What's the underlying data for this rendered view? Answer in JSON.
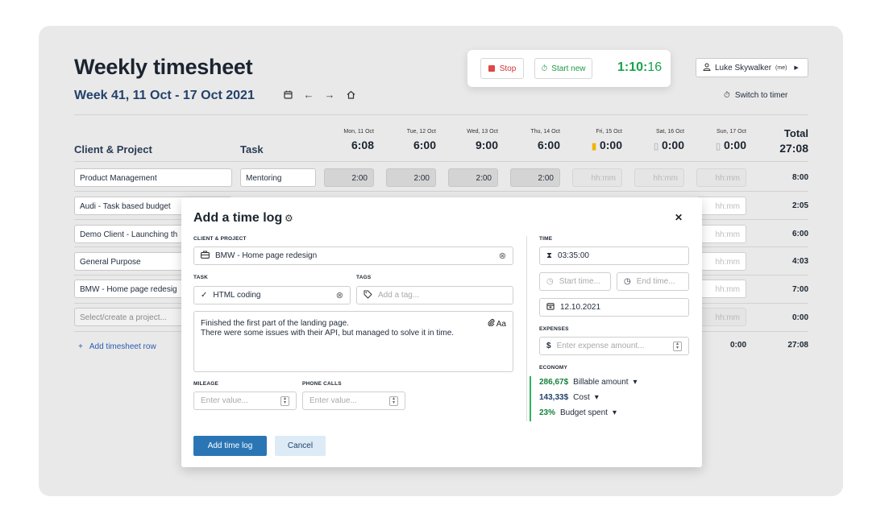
{
  "header": {
    "title": "Weekly timesheet",
    "week_label": "Week 41, 11 Oct - 17 Oct 2021",
    "switch_timer": "Switch to timer"
  },
  "timer": {
    "stop_label": "Stop",
    "start_label": "Start new",
    "clock_main": "1:10:",
    "clock_sec": "16"
  },
  "user": {
    "name": "Luke Skywalker",
    "me": "(me)"
  },
  "table": {
    "col_project": "Client & Project",
    "col_task": "Task",
    "col_total": "Total",
    "days": [
      {
        "name": "Mon, 11 Oct",
        "total": "6:08",
        "indicator": ""
      },
      {
        "name": "Tue, 12 Oct",
        "total": "6:00",
        "indicator": ""
      },
      {
        "name": "Wed, 13 Oct",
        "total": "9:00",
        "indicator": ""
      },
      {
        "name": "Thu, 14 Oct",
        "total": "6:00",
        "indicator": ""
      },
      {
        "name": "Fri, 15 Oct",
        "total": "0:00",
        "indicator": "yellow"
      },
      {
        "name": "Sat, 16 Oct",
        "total": "0:00",
        "indicator": "grey"
      },
      {
        "name": "Sun, 17 Oct",
        "total": "0:00",
        "indicator": "grey"
      }
    ],
    "grand_total": "27:08",
    "rows": [
      {
        "project": "Product Management",
        "task": "Mentoring",
        "cells": [
          "2:00",
          "2:00",
          "2:00",
          "2:00",
          "hh:mm",
          "hh:mm",
          "hh:mm"
        ],
        "total": "8:00"
      },
      {
        "project": "Audi - Task based budget",
        "total": "2:05",
        "sun": "hh:mm"
      },
      {
        "project": "Demo Client - Launching th",
        "total": "6:00",
        "sun": "hh:mm"
      },
      {
        "project": "General Purpose",
        "total": "4:03",
        "sun": "hh:mm"
      },
      {
        "project": "BMW - Home page redesig",
        "total": "7:00",
        "sun": "hh:mm"
      },
      {
        "project_placeholder": "Select/create a project...",
        "total": "0:00",
        "sun": "hh:mm"
      }
    ],
    "add_row": "Add timesheet row",
    "footer_sun": "0:00",
    "footer_total": "27:08"
  },
  "modal": {
    "title": "Add a time log",
    "client_label": "CLIENT & PROJECT",
    "client_value": "BMW - Home page redesign",
    "task_label": "TASK",
    "task_value": "HTML coding",
    "tags_label": "TAGS",
    "tags_placeholder": "Add a tag...",
    "notes_line1": "Finished the first part of the landing page.",
    "notes_line2": "There were some issues with their API, but managed to solve it in time.",
    "notes_format": "Aa",
    "mileage_label": "MILEAGE",
    "mileage_placeholder": "Enter value...",
    "phone_label": "PHONE CALLS",
    "phone_placeholder": "Enter value...",
    "time_label": "TIME",
    "time_value": "03:35:00",
    "start_placeholder": "Start time...",
    "end_placeholder": "End time...",
    "date_value": "12.10.2021",
    "expenses_label": "EXPENSES",
    "expense_currency": "$",
    "expense_placeholder": "Enter expense amount...",
    "economy_label": "ECONOMY",
    "billable_amount": "286,67$",
    "billable_label": "Billable amount",
    "cost_amount": "143,33$",
    "cost_label": "Cost",
    "budget_amount": "23%",
    "budget_label": "Budget spent",
    "submit_label": "Add time log",
    "cancel_label": "Cancel"
  },
  "colors": {
    "accent_blue": "#2a76b5",
    "green": "#17a34a",
    "stop_red": "#e04747"
  }
}
